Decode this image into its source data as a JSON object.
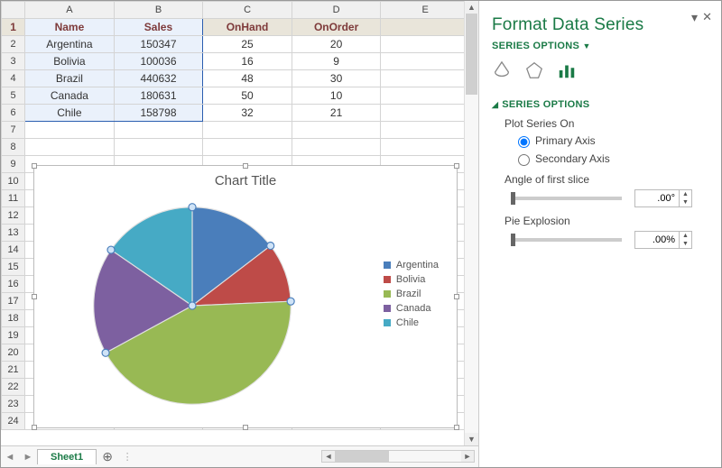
{
  "columns": [
    "A",
    "B",
    "C",
    "D",
    "E"
  ],
  "rows_shown": 24,
  "table": {
    "headers": [
      "Name",
      "Sales",
      "OnHand",
      "OnOrder"
    ],
    "rows": [
      {
        "name": "Argentina",
        "sales": 150347,
        "onhand": 25,
        "onorder": 20
      },
      {
        "name": "Bolivia",
        "sales": 100036,
        "onhand": 16,
        "onorder": 9
      },
      {
        "name": "Brazil",
        "sales": 440632,
        "onhand": 48,
        "onorder": 30
      },
      {
        "name": "Canada",
        "sales": 180631,
        "onhand": 50,
        "onorder": 10
      },
      {
        "name": "Chile",
        "sales": 158798,
        "onhand": 32,
        "onorder": 21
      }
    ]
  },
  "chart_data": {
    "type": "pie",
    "title": "Chart Title",
    "categories": [
      "Argentina",
      "Bolivia",
      "Brazil",
      "Canada",
      "Chile"
    ],
    "values": [
      150347,
      100036,
      440632,
      180631,
      158798
    ],
    "colors": [
      "#4a7ebb",
      "#be4b48",
      "#98b954",
      "#7d60a0",
      "#46aac5"
    ],
    "angle_of_first_slice": 0,
    "pie_explosion_pct": 0
  },
  "sheet_tab": "Sheet1",
  "pane": {
    "title": "Format Data Series",
    "series_options_label": "SERIES OPTIONS",
    "section_label": "SERIES OPTIONS",
    "plot_on_label": "Plot Series On",
    "primary_label": "Primary Axis",
    "secondary_label": "Secondary Axis",
    "plot_on_selected": "primary",
    "angle_label": "Angle of first slice",
    "angle_value": ".00°",
    "explosion_label": "Pie Explosion",
    "explosion_value": ".00%"
  }
}
